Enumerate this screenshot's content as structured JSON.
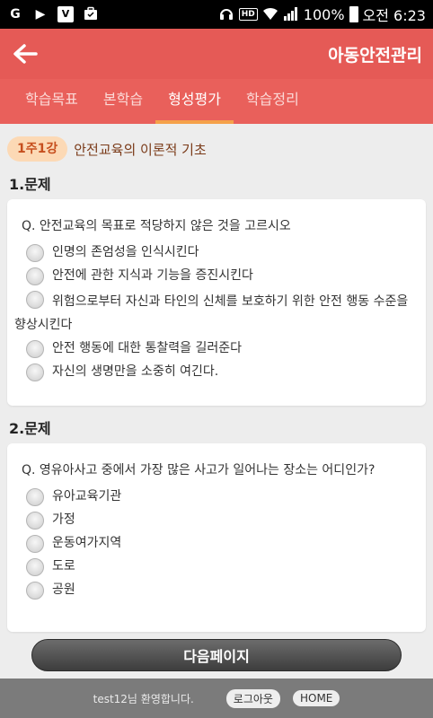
{
  "status_bar": {
    "left_icons": [
      "g-icon",
      "play-icon",
      "vs-icon",
      "briefcase-icon"
    ],
    "hd_label": "HD",
    "battery": "100%",
    "time": "오전 6:23"
  },
  "appbar": {
    "title": "아동안전관리"
  },
  "tabs": [
    {
      "label": "학습목표",
      "active": false
    },
    {
      "label": "본학습",
      "active": false
    },
    {
      "label": "형성평가",
      "active": true
    },
    {
      "label": "학습정리",
      "active": false
    }
  ],
  "lesson": {
    "badge": "1주1강",
    "title": "안전교육의 이론적 기초"
  },
  "questions": [
    {
      "label": "1.문제",
      "text": "Q. 안전교육의 목표로 적당하지 않은 것을 고르시오",
      "options": [
        "인명의 존엄성을 인식시킨다",
        "안전에 관한 지식과 기능을 증진시킨다",
        "위험으로부터 자신과 타인의 신체를 보호하기 위한 안전 행동 수준을 향상시킨다",
        "안전 행동에 대한 통찰력을 길러준다",
        "자신의 생명만을 소중히 여긴다."
      ]
    },
    {
      "label": "2.문제",
      "text": "Q. 영유아사고 중에서 가장 많은 사고가 일어나는 장소는 어디인가?",
      "options": [
        "유아교육기관",
        "가정",
        "운동여가지역",
        "도로",
        "공원"
      ]
    }
  ],
  "next_button": "다음페이지",
  "footer": {
    "welcome": "test12님 환영합니다.",
    "logout": "로그아웃",
    "home": "HOME"
  },
  "colors": {
    "appbar": "#e55a56",
    "tabs": "#e9605b",
    "tab_indicator": "#f5a14a",
    "badge_bg": "#fcd9b5",
    "footer": "#7b7b7b"
  }
}
